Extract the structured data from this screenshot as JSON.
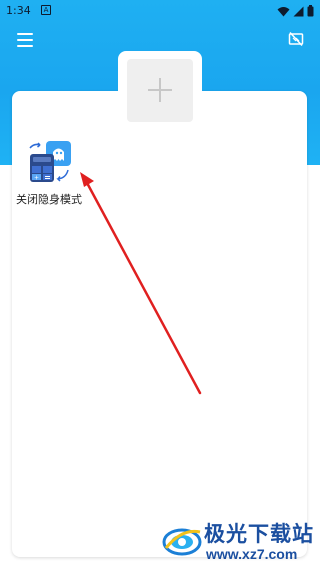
{
  "status_bar": {
    "time": "1:34",
    "notification_letter": "A"
  },
  "header": {
    "menu_icon": "hamburger-menu-icon",
    "hide_icon": "hide-screen-icon"
  },
  "main": {
    "add_button_icon": "plus-icon",
    "apps": [
      {
        "label": "关闭隐身模式",
        "icon": "ghost-calculator-icon"
      }
    ]
  },
  "watermark": {
    "title": "极光下载站",
    "url": "www.xz7.com"
  },
  "colors": {
    "header_blue": "#1aa6ef",
    "arrow_red": "#e02020",
    "watermark_blue": "#1b4fa0"
  }
}
